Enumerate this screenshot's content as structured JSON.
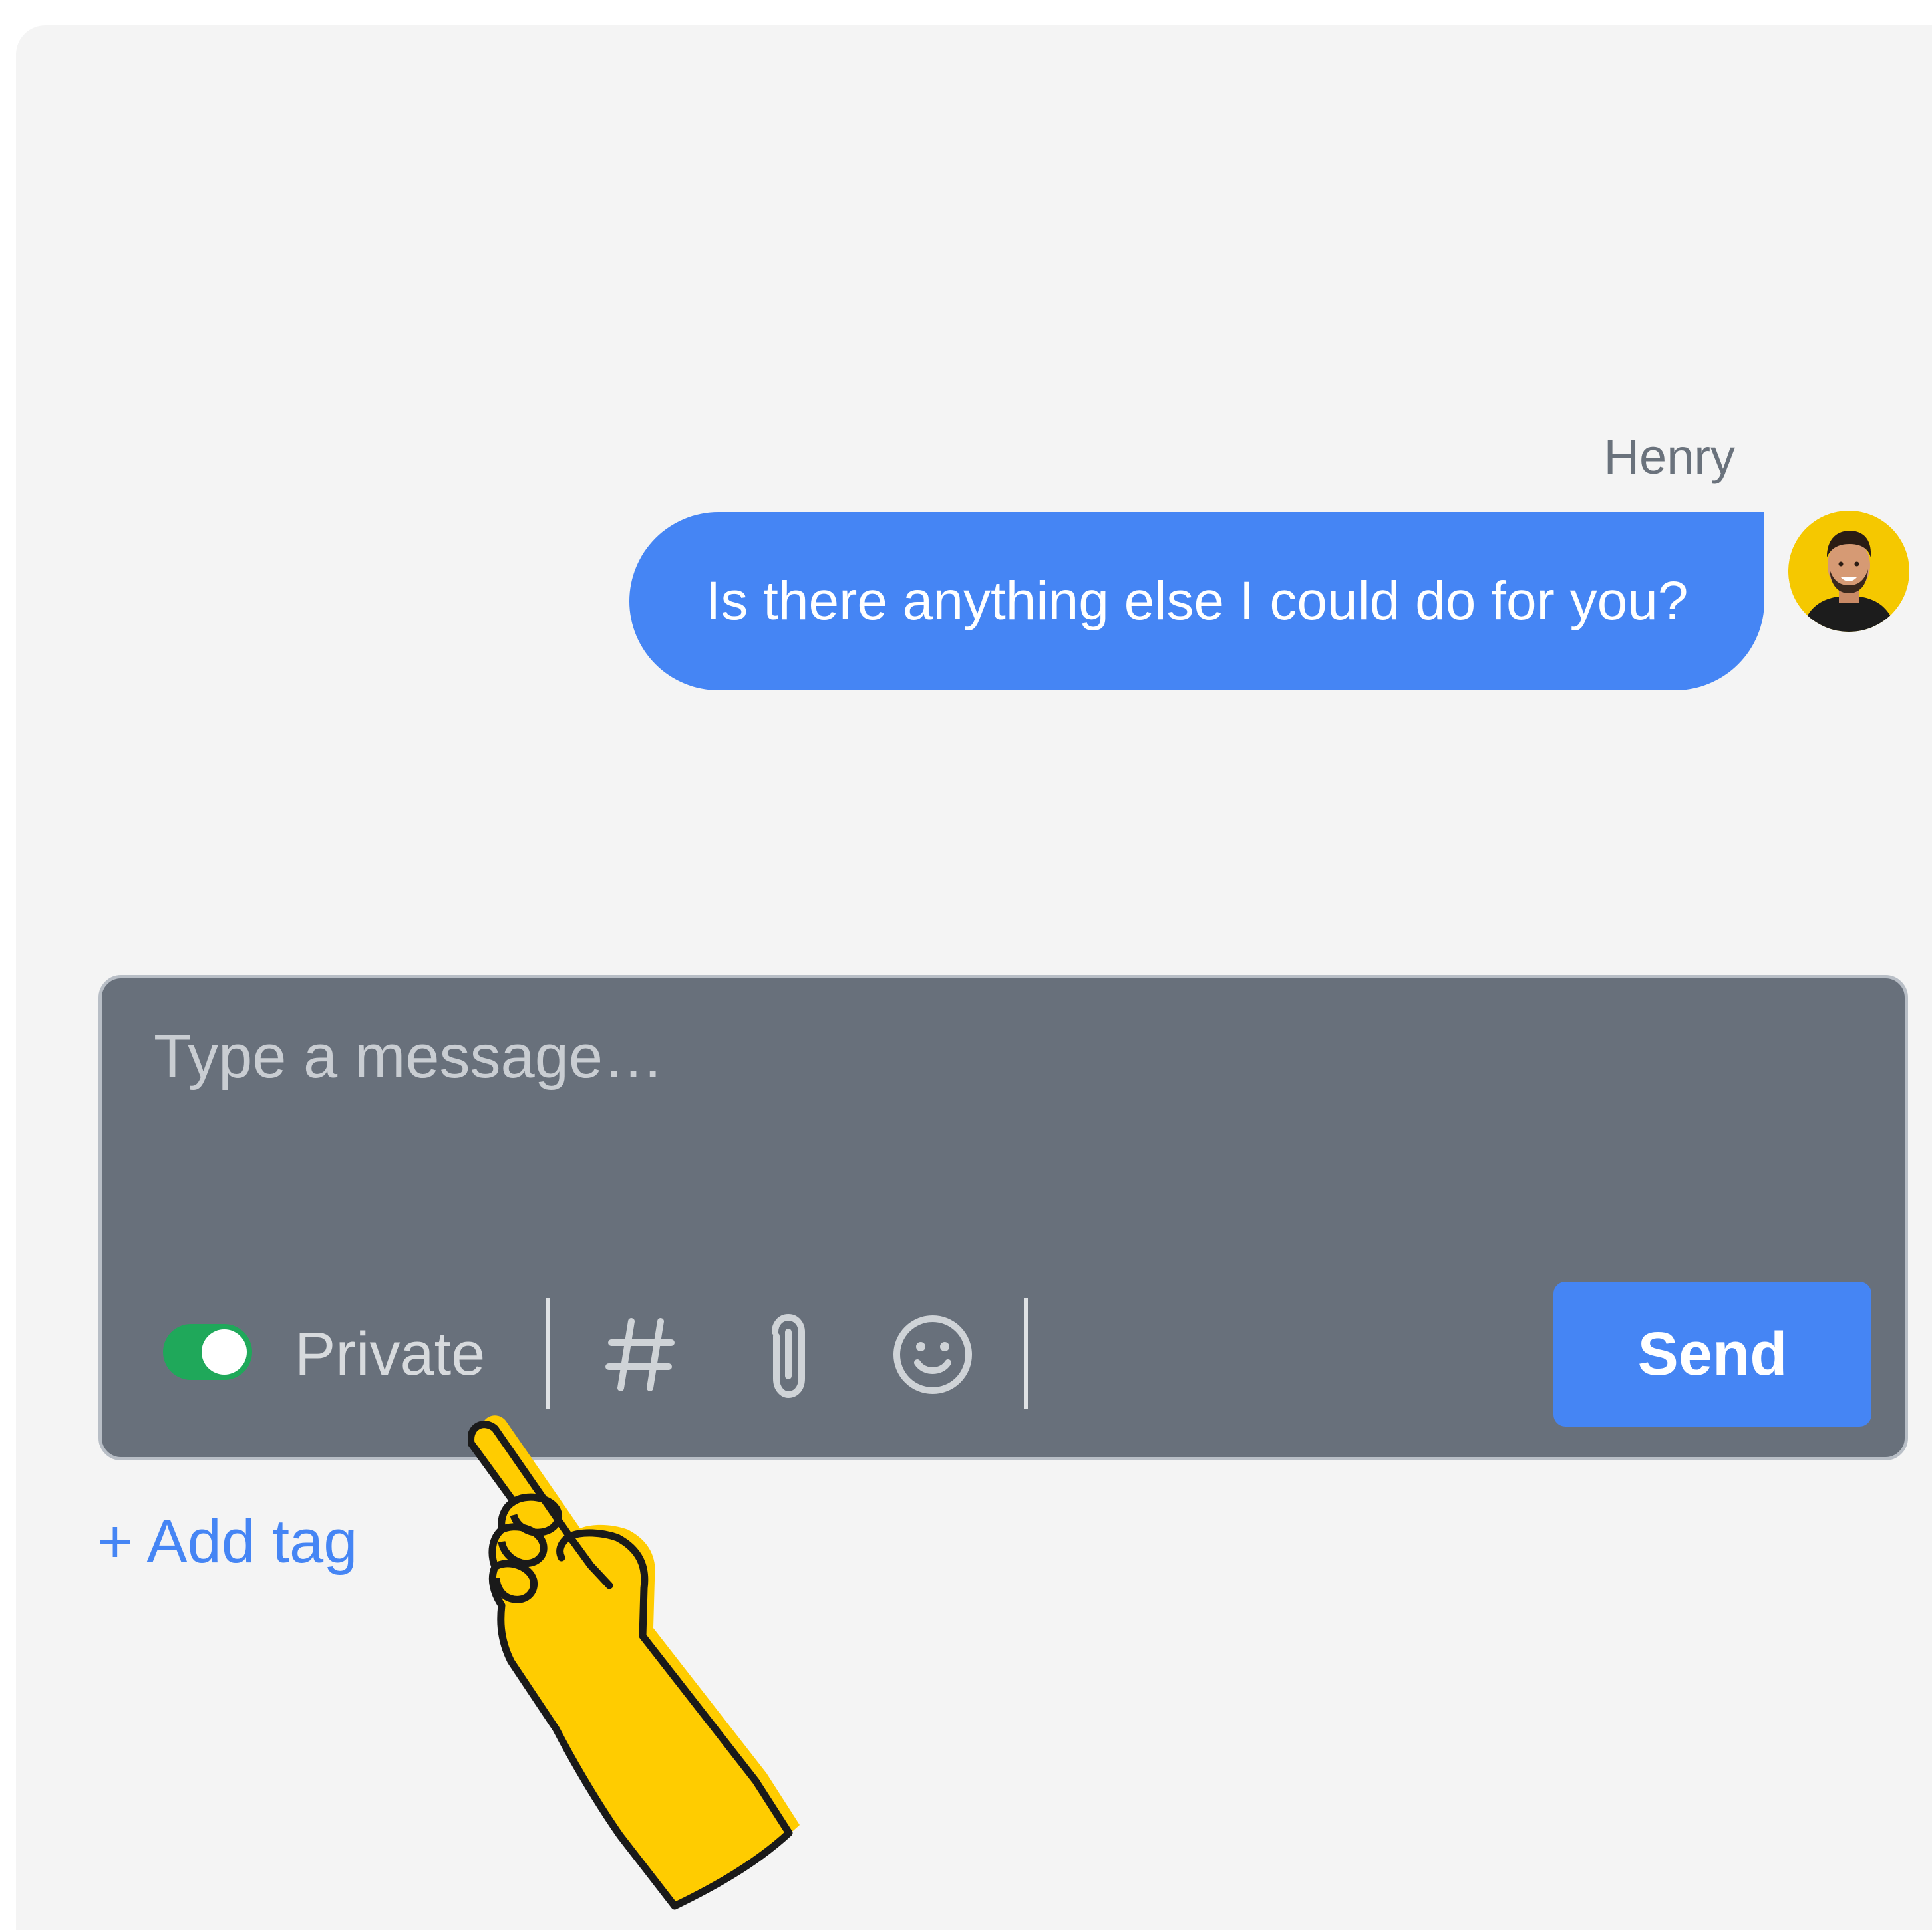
{
  "conversation": {
    "message": {
      "sender": "Henry",
      "text": "Is there anything else I could do for you?"
    }
  },
  "composer": {
    "placeholder": "Type a message…",
    "value": "",
    "private_label": "Private",
    "private_enabled": true,
    "send_label": "Send",
    "tools": [
      "hashtag-icon",
      "paperclip-icon",
      "emoji-icon"
    ]
  },
  "add_tag_label": "+ Add tag",
  "colors": {
    "accent": "#4585f4",
    "toggle_on": "#1fa85a",
    "composer_bg": "#68707b",
    "panel_bg": "#f4f4f4",
    "avatar_bg": "#f5c800",
    "hand": "#ffcc00"
  }
}
